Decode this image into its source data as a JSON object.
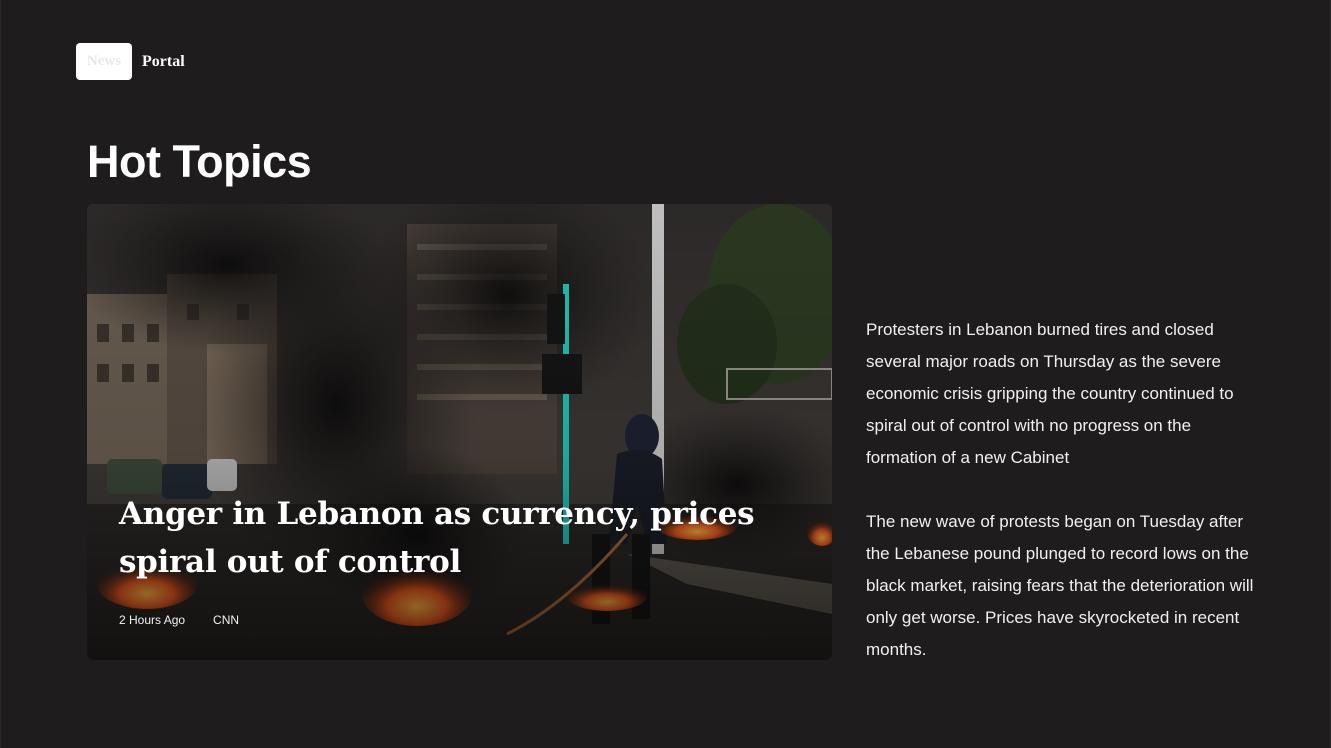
{
  "logo": {
    "badge_text": "News",
    "name": "Portal"
  },
  "page_title": "Hot Topics",
  "hero": {
    "headline": "Anger in Lebanon as currency, prices spiral out of control",
    "time": "2 Hours Ago",
    "source": "CNN"
  },
  "article": {
    "paragraphs": [
      "Protesters in Lebanon burned tires and closed several major roads on Thursday as the severe economic crisis gripping the country continued to spiral out of control with no progress on the formation of a new Cabinet",
      "The new wave of protests began on Tuesday after the Lebanese pound plunged to record lows on the black market, raising fears that the deterioration will only get worse. Prices have skyrocketed in recent months."
    ]
  },
  "colors": {
    "background": "#1f1c1e",
    "text": "#ffffff",
    "fire": "#e8581c"
  }
}
